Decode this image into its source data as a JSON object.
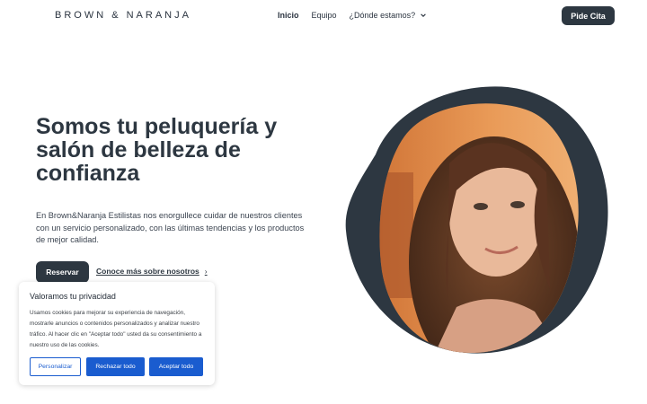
{
  "header": {
    "logo": "BROWN & NARANJA",
    "nav": [
      {
        "label": "Inicio"
      },
      {
        "label": "Equipo"
      },
      {
        "label": "¿Dónde estamos?"
      }
    ],
    "cta": "Pide Cita"
  },
  "hero": {
    "title": "Somos tu peluquería y salón de belleza de confianza",
    "text": "En Brown&Naranja Estilistas nos enorgullece cuidar de nuestros clientes con un servicio personalizado, con las últimas tendencias y los productos de mejor calidad.",
    "primary_button": "Reservar",
    "secondary_link": "Conoce más sobre nosotros",
    "secondary_link_icon": "chevron-right-icon"
  },
  "cookie_banner": {
    "title": "Valoramos tu privacidad",
    "body": "Usamos cookies para mejorar su experiencia de navegación, mostrarle anuncios o contenidos personalizados y analizar nuestro tráfico. Al hacer clic en \"Aceptar todo\" usted da su consentimiento a nuestro uso de las cookies.",
    "buttons": {
      "customize": "Personalizar",
      "reject": "Rechazar todo",
      "accept": "Aceptar todo"
    }
  },
  "colors": {
    "dark": "#2d3741",
    "accent_blue": "#1a5ccf",
    "orange": "#e8883b"
  }
}
